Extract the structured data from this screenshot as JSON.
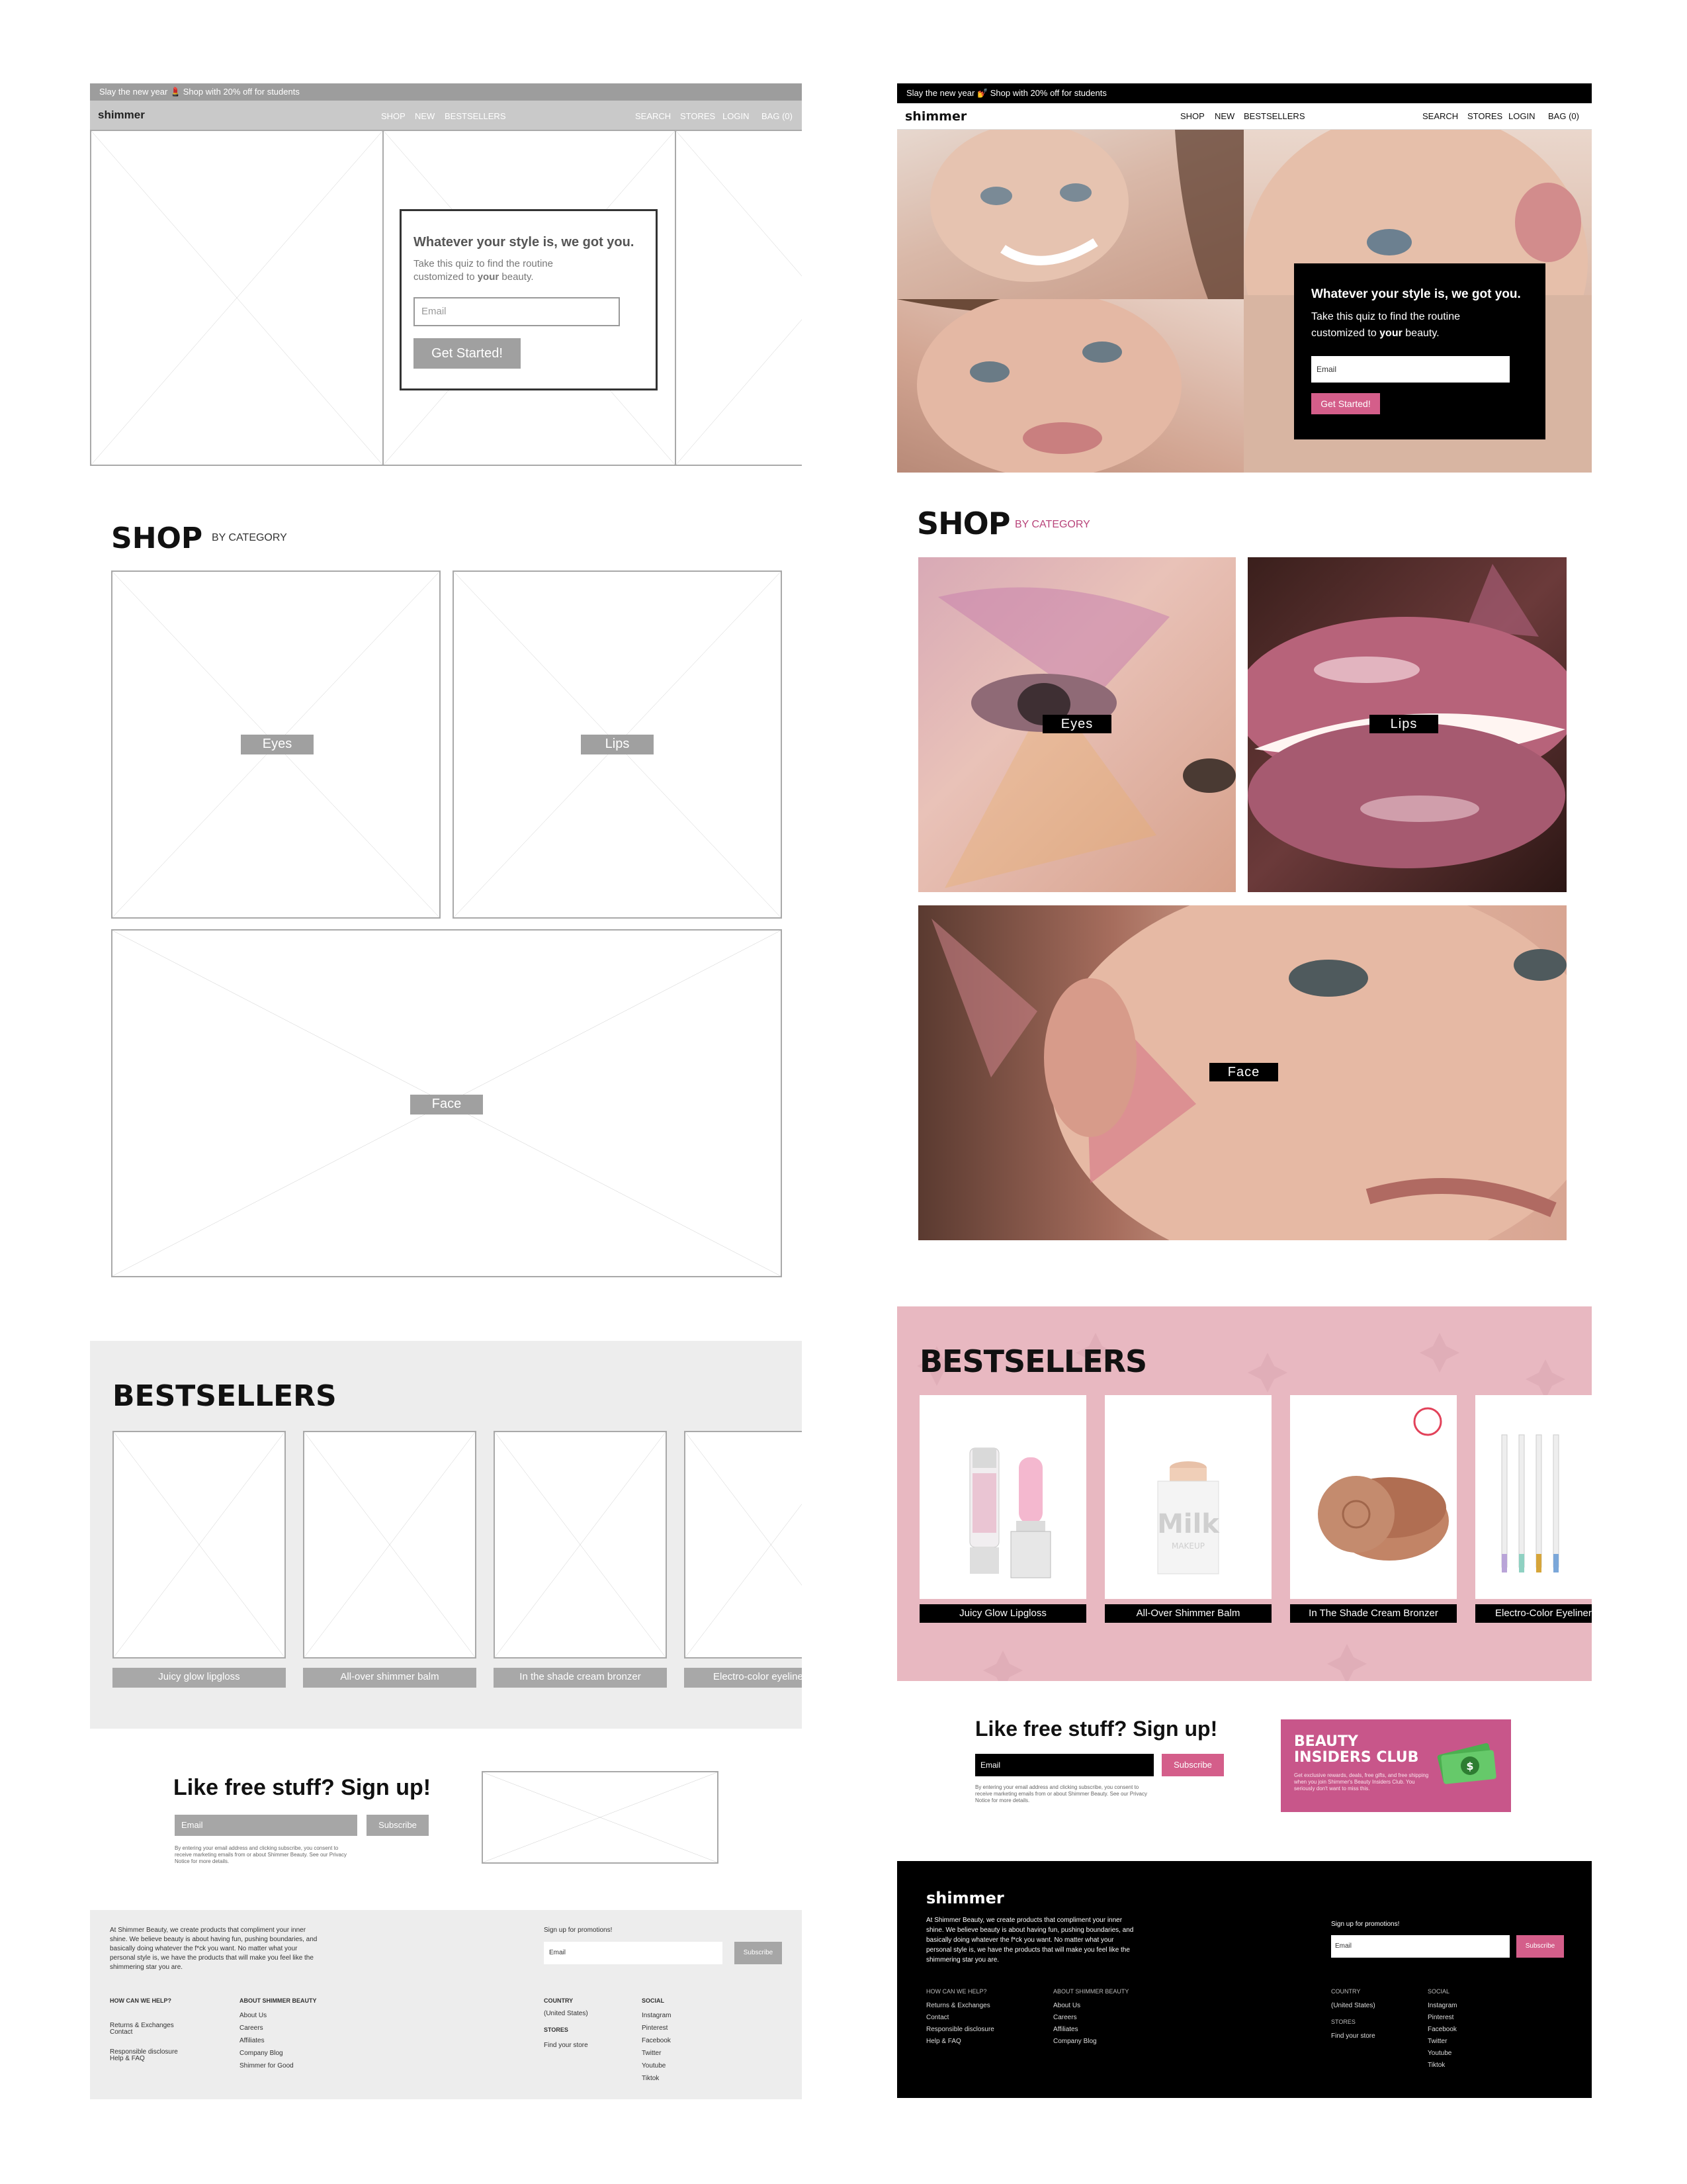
{
  "announcement": {
    "wireframe": "Slay the new year 💄 Shop with 20% off for students",
    "design": "Slay the new year 💅 Shop with 20% off for students"
  },
  "nav": {
    "logo": "shimmer",
    "center": [
      "SHOP",
      "NEW",
      "BESTSELLERS"
    ],
    "right": [
      "SEARCH",
      "STORES",
      "LOGIN",
      "BAG (0)"
    ]
  },
  "quiz": {
    "title": "Whatever your style is, we got you.",
    "body_pre": "Take this quiz to find the routine customized to ",
    "body_bold": "your",
    "body_post": " beauty.",
    "placeholder_wire": "Email",
    "placeholder_design": "Email",
    "button_wire": "Get Started!",
    "button_design": "Get Started!"
  },
  "shop": {
    "title": "SHOP",
    "subtitle": "BY CATEGORY",
    "categories": [
      "Eyes",
      "Lips",
      "Face"
    ]
  },
  "bestsellers": {
    "title": "BESTSELLERS",
    "wire_items": [
      "Juicy glow lipgloss",
      "All-over shimmer balm",
      "In the shade cream bronzer",
      "Electro-color eyeliner"
    ],
    "design_items": [
      "Juicy Glow Lipgloss",
      "All-Over Shimmer Balm",
      "In The Shade Cream Bronzer",
      "Electro-Color Eyeliner"
    ],
    "milk_text": "Milk",
    "makeup_text": "MAKEUP"
  },
  "signup": {
    "title": "Like free stuff? Sign up!",
    "email_placeholder": "Email",
    "button": "Subscribe",
    "fine_print": "By entering your email address and clicking subscribe, you consent to receive marketing emails from or about Shimmer Beauty. See our Privacy Notice for more details."
  },
  "club": {
    "title_line1": "BEAUTY",
    "title_line2": "INSIDERS CLUB",
    "text": "Get exclusive rewards, deals, free gifts, and free shipping when you join Shimmer's Beauty Insiders Club. You seriously don't want to miss this."
  },
  "footer": {
    "logo": "shimmer",
    "about": "At Shimmer Beauty, we create products that compliment your inner shine. We believe beauty is about having fun, pushing boundaries, and basically doing whatever the f*ck you want. No matter what your personal style is, we have the products that will make you feel like the shimmering star you are.",
    "promo_label": "Sign up for promotions!",
    "email_wire": "Email",
    "email_design": "Email",
    "subscribe": "Subscribe",
    "help_title": "HOW CAN WE HELP?",
    "help_wire": [
      "Returns & Exchanges",
      "Contact",
      "Responsible disclosure",
      "Help & FAQ"
    ],
    "help_design": [
      "Returns & Exchanges",
      "Contact",
      "Responsible disclosure",
      "Help & FAQ"
    ],
    "about_title": "ABOUT SHIMMER BEAUTY",
    "about_wire": [
      "About Us",
      "Careers",
      "Affiliates",
      "Company Blog",
      "Shimmer for Good"
    ],
    "about_design": [
      "About Us",
      "Careers",
      "Affiliates",
      "Company Blog"
    ],
    "country_title": "COUNTRY",
    "country": "(United States)",
    "stores_title": "STORES",
    "stores": "Find your store",
    "social_title": "SOCIAL",
    "social": [
      "Instagram",
      "Pinterest",
      "Facebook",
      "Twitter",
      "Youtube",
      "Tiktok"
    ]
  },
  "colors": {
    "accent_pink": "#d45e8a",
    "bestseller_bg": "#e8b8c1",
    "wire_gray": "#a0a0a0"
  }
}
